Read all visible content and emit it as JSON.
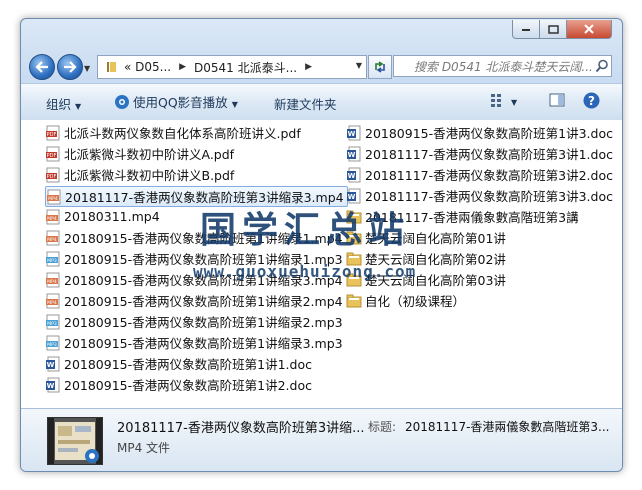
{
  "address": {
    "crumbs": [
      "«  D05...",
      "D0541 北派泰斗..."
    ]
  },
  "search": {
    "placeholder": "搜索 D0541 北派泰斗楚天云阔..."
  },
  "toolbar": {
    "organize": "组织",
    "qqplayer": "使用QQ影音播放",
    "new_folder": "新建文件夹"
  },
  "files_col1": [
    {
      "name": "北派斗数两仪象数自化体系高阶班讲义.pdf",
      "type": "pdf"
    },
    {
      "name": "北派紫微斗数初中阶讲义A.pdf",
      "type": "pdf"
    },
    {
      "name": "北派紫微斗数初中阶讲义B.pdf",
      "type": "pdf"
    },
    {
      "name": "20181117-香港两仪象数高阶班第3讲缩录3.mp4",
      "type": "mp4",
      "selected": true
    },
    {
      "name": "20180311.mp4",
      "type": "mp4"
    },
    {
      "name": "20180915-香港两仪象数高阶班第1讲缩录1.mp4",
      "type": "mp4"
    },
    {
      "name": "20180915-香港两仪象数高阶班第1讲缩录1.mp3",
      "type": "mp3"
    },
    {
      "name": "20180915-香港两仪象数高阶班第1讲缩录3.mp4",
      "type": "mp4"
    },
    {
      "name": "20180915-香港两仪象数高阶班第1讲缩录2.mp4",
      "type": "mp4"
    },
    {
      "name": "20180915-香港两仪象数高阶班第1讲缩录2.mp3",
      "type": "mp3"
    },
    {
      "name": "20180915-香港两仪象数高阶班第1讲缩录3.mp3",
      "type": "mp3"
    },
    {
      "name": "20180915-香港两仪象数高阶班第1讲1.doc",
      "type": "doc"
    },
    {
      "name": "20180915-香港两仪象数高阶班第1讲2.doc",
      "type": "doc"
    }
  ],
  "files_col2": [
    {
      "name": "20180915-香港两仪象数高阶班第1讲3.doc",
      "type": "doc"
    },
    {
      "name": "20181117-香港两仪象数高阶班第3讲1.doc",
      "type": "doc"
    },
    {
      "name": "20181117-香港两仪象数高阶班第3讲2.doc",
      "type": "doc"
    },
    {
      "name": "20181117-香港两仪象数高阶班第3讲3.doc",
      "type": "doc"
    },
    {
      "name": "20181117-香港兩儀象數高階班第3講",
      "type": "folder"
    },
    {
      "name": "楚天云阔自化高阶第01讲",
      "type": "folder"
    },
    {
      "name": "楚天云阔自化高阶第02讲",
      "type": "folder"
    },
    {
      "name": "楚天云阔自化高阶第03讲",
      "type": "folder"
    },
    {
      "name": "自化（初级课程）",
      "type": "folder"
    }
  ],
  "details": {
    "name": "20181117-香港两仪象数高阶班第3讲缩...",
    "type": "MP4 文件",
    "label": "标题:",
    "value": "20181117-香港兩儀象數高階班第3..."
  },
  "watermark": {
    "text": "国学汇总站",
    "url": "www.guoxuehuizong.com"
  },
  "colors": {
    "pdf": "#c0392b",
    "mp4": "#d9764a",
    "mp3": "#4a9fd6",
    "doc": "#2b5797",
    "folder": "#e8c25a",
    "accent": "#84acdd"
  }
}
